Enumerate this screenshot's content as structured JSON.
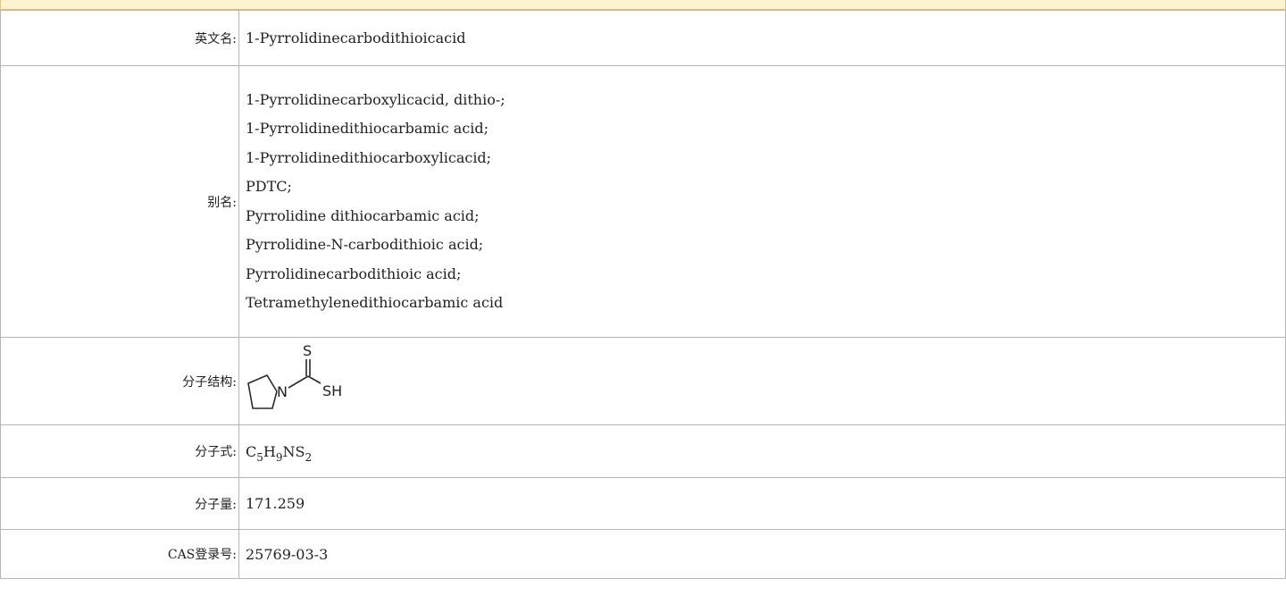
{
  "rows": {
    "english_name": {
      "label": "英文名:",
      "value": "1-Pyrrolidinecarbodithioicacid"
    },
    "aliases": {
      "label": "别名:",
      "items": [
        "1-Pyrrolidinecarboxylicacid, dithio-;",
        "1-Pyrrolidinedithiocarbamic acid;",
        "1-Pyrrolidinedithiocarboxylicacid;",
        "PDTC;",
        "Pyrrolidine dithiocarbamic acid;",
        "Pyrrolidine-N-carbodithioic acid;",
        "Pyrrolidinecarbodithioic acid;",
        "Tetramethylenedithiocarbamic acid"
      ]
    },
    "structure": {
      "label": "分子结构:",
      "atoms": {
        "s_top": "S",
        "n": "N",
        "sh": "SH"
      }
    },
    "formula": {
      "label": "分子式:",
      "parts": {
        "c": "C",
        "c_n": "5",
        "h": "H",
        "h_n": "9",
        "ns": "NS",
        "s_n": "2"
      }
    },
    "molecular_weight": {
      "label": "分子量:",
      "value": "171.259"
    },
    "cas": {
      "label": "CAS登录号:",
      "value": "25769-03-3"
    }
  }
}
